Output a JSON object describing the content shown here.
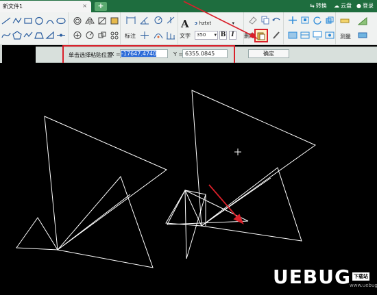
{
  "window": {
    "tab_title": "新文件1",
    "tab_close_glyph": "×",
    "add_tab_glyph": "+",
    "right_actions": [
      {
        "label": "转换",
        "icon": "convert-icon"
      },
      {
        "label": "云盘",
        "icon": "cloud-icon"
      },
      {
        "label": "登录",
        "icon": "user-icon"
      }
    ]
  },
  "ribbon": {
    "annotate_label": "标注",
    "text_label": "文字",
    "font_name": "hztxt",
    "font_size": "350",
    "bold_label": "B",
    "italic_label": "I",
    "delete_label": "删除",
    "measure_label": "测量",
    "text_glyph": "A"
  },
  "command": {
    "prompt": "单击选择粘贴位置",
    "x_label": "X =",
    "x_value": "-17647.4740",
    "y_label": "Y =",
    "y_value": "6355.0845",
    "ok_label": "确定"
  },
  "watermark": {
    "text": "UEBUG",
    "badge": "下载站",
    "url": "www.uebug.com"
  },
  "colors": {
    "title_bar": "#1e6d3e",
    "highlight_frame": "#d9202a",
    "annotation_arrow": "#d9202a",
    "canvas_bg": "#000000",
    "drawing_lines": "#ffffff"
  }
}
